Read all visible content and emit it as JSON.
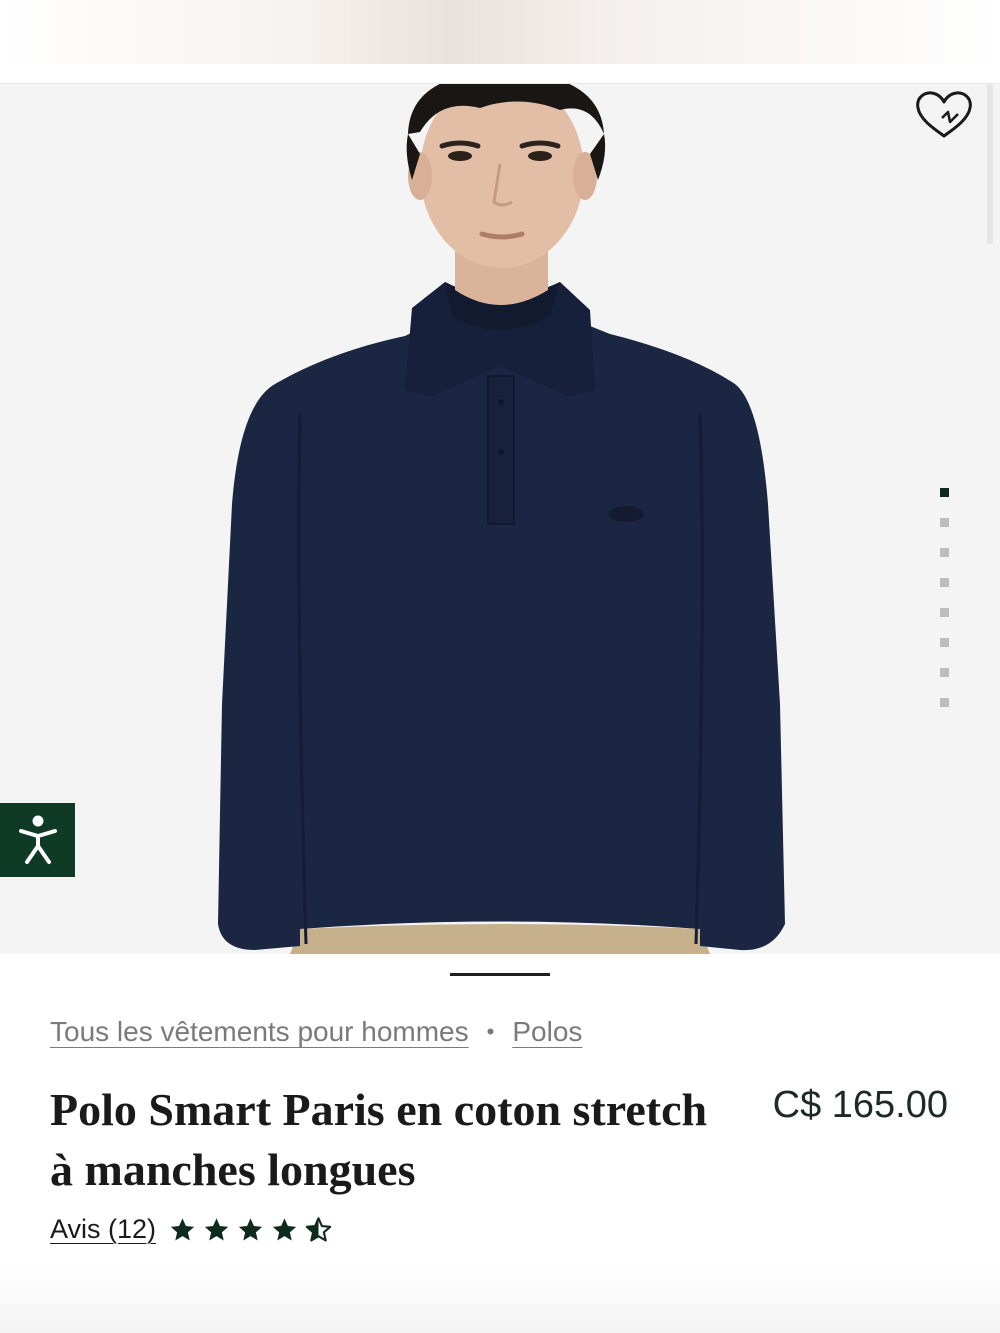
{
  "gallery": {
    "image_alt": "Homme portant un polo bleu marine à manches longues",
    "slide_count": 8,
    "active_slide": 1
  },
  "breadcrumb": {
    "items": [
      "Tous les vêtements pour hommes",
      "Polos"
    ],
    "separator": "•"
  },
  "product": {
    "title": "Polo Smart Paris en coton stretch à manches longues",
    "price": "C$ 165.00"
  },
  "reviews": {
    "label": "Avis (12)",
    "rating": 4.5,
    "max": 5
  },
  "colors": {
    "accent": "#0f3b26",
    "shirt": "#1a2540",
    "background": "#f4f4f4"
  },
  "icons": {
    "wishlist": "heart-icon",
    "accessibility": "accessibility-icon",
    "star": "star-icon"
  }
}
